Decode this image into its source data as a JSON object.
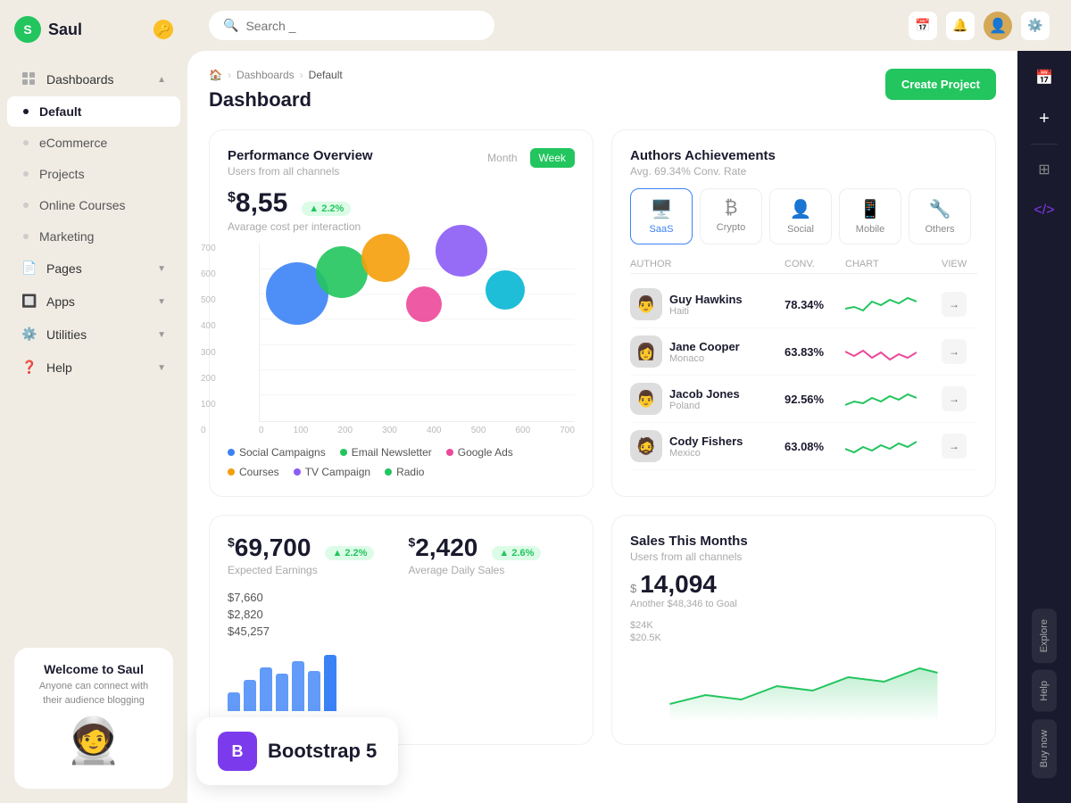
{
  "app": {
    "name": "Saul",
    "logo_letter": "S"
  },
  "sidebar": {
    "items": [
      {
        "id": "dashboards",
        "label": "Dashboards",
        "has_chevron": true,
        "has_icon": true,
        "icon": "grid"
      },
      {
        "id": "default",
        "label": "Default",
        "active": true,
        "is_sub": true
      },
      {
        "id": "ecommerce",
        "label": "eCommerce",
        "is_sub": true
      },
      {
        "id": "projects",
        "label": "Projects",
        "is_sub": true
      },
      {
        "id": "online-courses",
        "label": "Online Courses",
        "is_sub": true
      },
      {
        "id": "marketing",
        "label": "Marketing",
        "is_sub": true
      },
      {
        "id": "pages",
        "label": "Pages",
        "has_chevron": true,
        "has_icon": true,
        "icon": "doc"
      },
      {
        "id": "apps",
        "label": "Apps",
        "has_chevron": true,
        "has_icon": true,
        "icon": "app"
      },
      {
        "id": "utilities",
        "label": "Utilities",
        "has_chevron": true,
        "has_icon": true,
        "icon": "util"
      },
      {
        "id": "help",
        "label": "Help",
        "has_chevron": true,
        "has_icon": true,
        "icon": "help"
      }
    ],
    "welcome": {
      "title": "Welcome to Saul",
      "subtitle": "Anyone can connect with their audience blogging"
    }
  },
  "topbar": {
    "search_placeholder": "Search _"
  },
  "breadcrumb": {
    "home": "🏠",
    "dashboards": "Dashboards",
    "current": "Default"
  },
  "page": {
    "title": "Dashboard",
    "create_btn": "Create Project"
  },
  "performance": {
    "title": "Performance Overview",
    "subtitle": "Users from all channels",
    "value": "8,55",
    "badge": "▲ 2.2%",
    "label": "Avarage cost per interaction",
    "tab_month": "Month",
    "tab_week": "Week",
    "y_axis": [
      "700",
      "600",
      "500",
      "400",
      "300",
      "200",
      "100",
      "0"
    ],
    "x_axis": [
      "0",
      "100",
      "200",
      "300",
      "400",
      "500",
      "600",
      "700"
    ],
    "bubbles": [
      {
        "color": "#3b82f6",
        "size": 70,
        "x": "18%",
        "y": "28%"
      },
      {
        "color": "#22c55e",
        "size": 60,
        "x": "28%",
        "y": "20%"
      },
      {
        "color": "#f59e0b",
        "size": 55,
        "x": "38%",
        "y": "10%"
      },
      {
        "color": "#ec4899",
        "size": 40,
        "x": "50%",
        "y": "32%"
      },
      {
        "color": "#8b5cf6",
        "size": 60,
        "x": "56%",
        "y": "5%"
      },
      {
        "color": "#06b6d4",
        "size": 45,
        "x": "67%",
        "y": "28%"
      }
    ],
    "legend": [
      {
        "label": "Social Campaigns",
        "color": "#3b82f6"
      },
      {
        "label": "Email Newsletter",
        "color": "#22c55e"
      },
      {
        "label": "Google Ads",
        "color": "#ec4899"
      },
      {
        "label": "Courses",
        "color": "#f59e0b"
      },
      {
        "label": "TV Campaign",
        "color": "#8b5cf6"
      },
      {
        "label": "Radio",
        "color": "#22c55e"
      }
    ]
  },
  "authors": {
    "title": "Authors Achievements",
    "subtitle": "Avg. 69.34% Conv. Rate",
    "categories": [
      {
        "id": "saas",
        "label": "SaaS",
        "icon": "🖥️",
        "active": true
      },
      {
        "id": "crypto",
        "label": "Crypto",
        "icon": "₿"
      },
      {
        "id": "social",
        "label": "Social",
        "icon": "👤"
      },
      {
        "id": "mobile",
        "label": "Mobile",
        "icon": "📱"
      },
      {
        "id": "others",
        "label": "Others",
        "icon": "🔧"
      }
    ],
    "table_headers": {
      "author": "AUTHOR",
      "conv": "CONV.",
      "chart": "CHART",
      "view": "VIEW"
    },
    "rows": [
      {
        "name": "Guy Hawkins",
        "country": "Haiti",
        "conv": "78.34%",
        "chart_color": "#22c55e",
        "avatar": "👨"
      },
      {
        "name": "Jane Cooper",
        "country": "Monaco",
        "conv": "63.83%",
        "chart_color": "#ec4899",
        "avatar": "👩"
      },
      {
        "name": "Jacob Jones",
        "country": "Poland",
        "conv": "92.56%",
        "chart_color": "#22c55e",
        "avatar": "👨"
      },
      {
        "name": "Cody Fishers",
        "country": "Mexico",
        "conv": "63.08%",
        "chart_color": "#22c55e",
        "avatar": "🧔"
      }
    ]
  },
  "stats": {
    "earnings": {
      "value": "69,700",
      "badge": "▲ 2.2%",
      "label": "Expected Earnings"
    },
    "daily_sales": {
      "value": "2,420",
      "badge": "▲ 2.6%",
      "label": "Average Daily Sales"
    },
    "amounts": [
      "$7,660",
      "$2,820",
      "$45,257"
    ]
  },
  "sales": {
    "title": "Sales This Months",
    "subtitle": "Users from all channels",
    "value": "14,094",
    "goal_text": "Another $48,346 to Goal",
    "y_labels": [
      "$24K",
      "$20.5K"
    ]
  },
  "right_panel": {
    "icons": [
      "📅",
      "+",
      "⊞",
      "</>"
    ],
    "labels": [
      "Explore",
      "Help",
      "Buy now"
    ]
  },
  "bootstrap_badge": {
    "letter": "B",
    "text": "Bootstrap 5"
  }
}
